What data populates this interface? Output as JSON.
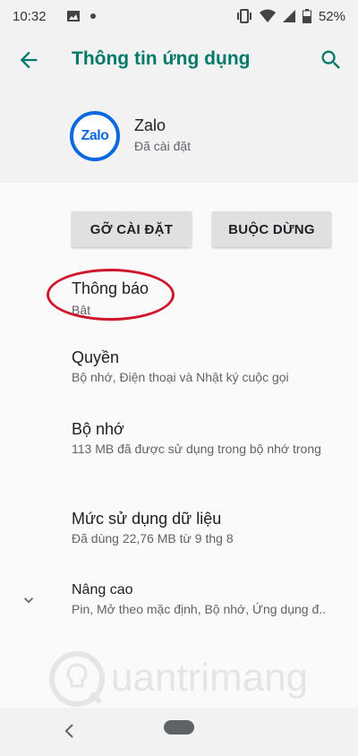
{
  "status_bar": {
    "time": "10:32",
    "battery": "52%",
    "icons": [
      "image-icon",
      "dot-icon",
      "vibrate-icon",
      "wifi-icon",
      "signal-icon",
      "battery-icon"
    ]
  },
  "appbar": {
    "title": "Thông tin ứng dụng",
    "back_icon": "arrow-back-icon",
    "search_icon": "search-icon",
    "accent": "#00796b"
  },
  "app": {
    "icon_text": "Zalo",
    "name": "Zalo",
    "status": "Đã cài đặt",
    "icon_color": "#0a68e0"
  },
  "actions": {
    "uninstall_label": "GỠ CÀI ĐẶT",
    "force_stop_label": "BUỘC DỪNG"
  },
  "settings": [
    {
      "title": "Thông báo",
      "subtitle": "Bật"
    },
    {
      "title": "Quyền",
      "subtitle": "Bộ nhớ, Điện thoại và Nhật ký cuộc gọi"
    },
    {
      "title": "Bộ nhớ",
      "subtitle": "113 MB đã được sử dụng trong bộ nhớ trong"
    },
    {
      "title": "Mức sử dụng dữ liệu",
      "subtitle": "Đã dùng 22,76 MB từ 9 thg 8"
    },
    {
      "title": "Nâng cao",
      "subtitle": "Pin, Mở theo mặc định, Bộ nhớ, Ứng dụng đ.."
    }
  ],
  "highlight_color": "#d0162a",
  "watermark": {
    "text": "uantrimang"
  }
}
